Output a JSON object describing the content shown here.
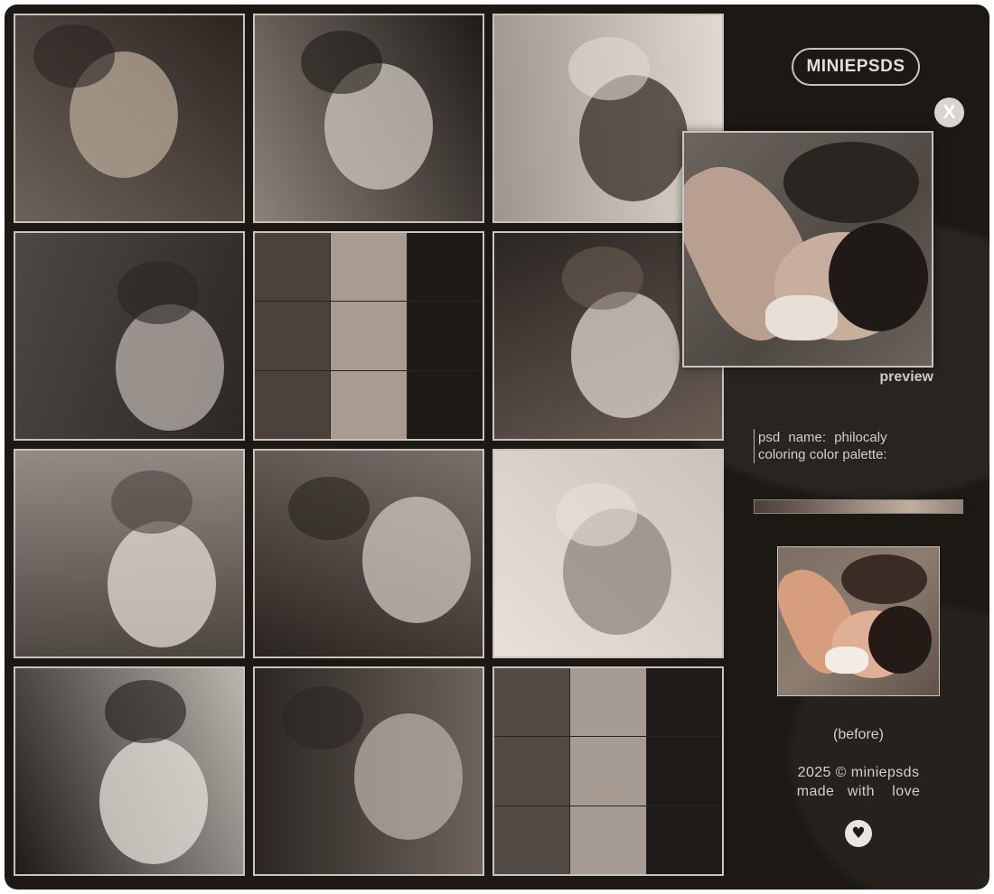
{
  "brand": {
    "logo_text": "MINIEPSDS"
  },
  "close_button": {
    "label": "X"
  },
  "preview": {
    "label": "preview"
  },
  "psd": {
    "name_line": "psd name:  philocaly",
    "palette_line": "coloring color palette:"
  },
  "palette_colors": [
    "#4b3f3a",
    "#6e5f58",
    "#9a8b80",
    "#c0ae9c",
    "#8f8279"
  ],
  "before": {
    "label": "(before)"
  },
  "footer": {
    "copyright": "2025 © miniepsds",
    "made_with": "made   with    love"
  },
  "icons": {
    "heart": "heart-icon",
    "close": "close-icon"
  },
  "gallery": [
    {
      "name": "portrait-dark-hair",
      "tones": [
        "#6d6259",
        "#b8a898",
        "#2b2521"
      ]
    },
    {
      "name": "umbrella-street",
      "tones": [
        "#8b8279",
        "#cfc8bf",
        "#1f1b18"
      ]
    },
    {
      "name": "lace-headscarf",
      "tones": [
        "#9e958c",
        "#3a2d26",
        "#e0dad2"
      ]
    },
    {
      "name": "sunglasses-wall",
      "tones": [
        "#4b4845",
        "#b9b2ab",
        "#2a2724"
      ]
    },
    {
      "name": "mosaic-collage",
      "tones": [
        "#4a423b",
        "#a89c90",
        "#1d1916"
      ]
    },
    {
      "name": "plaid-jacket",
      "tones": [
        "#2a2522",
        "#ddd6cd",
        "#6a5d54"
      ]
    },
    {
      "name": "fire-escape-building",
      "tones": [
        "#948b83",
        "#e2dcd4",
        "#4c4641"
      ]
    },
    {
      "name": "winged-eyeliner",
      "tones": [
        "#797069",
        "#cfc7bf",
        "#2a2420"
      ]
    },
    {
      "name": "digital-camera",
      "tones": [
        "#cbc3b9",
        "#8e8780",
        "#e8e1d8"
      ]
    },
    {
      "name": "slicked-hair-portrait",
      "tones": [
        "#bcb6b0",
        "#e5e0da",
        "#1e1a18"
      ]
    },
    {
      "name": "terraced-street",
      "tones": [
        "#6c645c",
        "#b8afa6",
        "#2b2623"
      ]
    },
    {
      "name": "photo-collage",
      "tones": [
        "#514943",
        "#a59b92",
        "#1f1b18"
      ]
    }
  ]
}
